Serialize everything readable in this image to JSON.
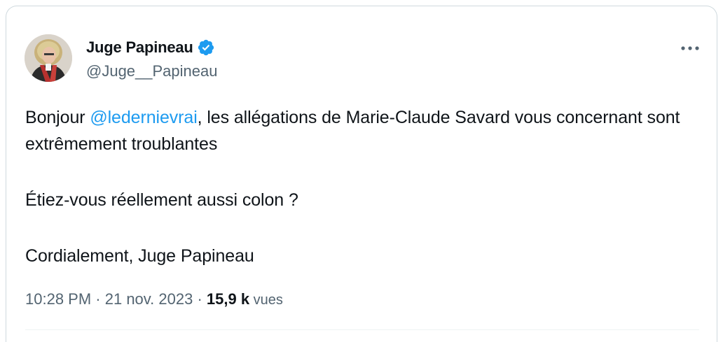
{
  "author": {
    "display_name": "Juge Papineau",
    "handle": "@Juge__Papineau",
    "verified": true
  },
  "tweet": {
    "line1_before": "Bonjour ",
    "mention": "@ledernievrai",
    "line1_after": ", les allégations de Marie-Claude Savard vous concernant sont extrêmement troublantes",
    "paragraph2": "Étiez-vous réellement aussi colon ?",
    "paragraph3": "Cordialement, Juge Papineau"
  },
  "meta": {
    "time": "10:28 PM",
    "separator1": " · ",
    "date": "21 nov. 2023",
    "separator2": " · ",
    "views_count": "15,9 k",
    "views_label": " vues"
  },
  "icons": {
    "verified": "verified-badge-icon",
    "more": "more-options-icon"
  },
  "colors": {
    "accent": "#1d9bf0",
    "text": "#0f1419",
    "secondary": "#536471",
    "border": "#cfd9de"
  }
}
